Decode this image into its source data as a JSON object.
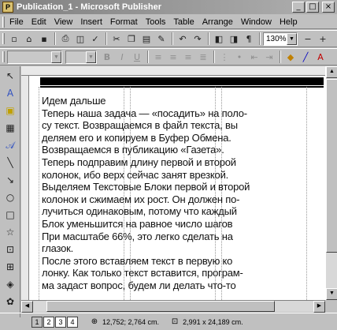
{
  "window": {
    "title": "Publication_1 - Microsoft Publisher",
    "app_icon": "publisher-icon",
    "controls": {
      "minimize": "_",
      "maximize": "□",
      "close": "×"
    }
  },
  "menu": [
    "File",
    "Edit",
    "View",
    "Insert",
    "Format",
    "Tools",
    "Table",
    "Arrange",
    "Window",
    "Help"
  ],
  "toolbar1": {
    "buttons": [
      "new-icon",
      "open-icon",
      "save-icon",
      "print-icon",
      "print-preview-icon",
      "spelling-icon",
      "cut-icon",
      "copy-icon",
      "paste-icon",
      "format-painter-icon",
      "undo-icon",
      "redo-icon",
      "bring-front-icon",
      "send-back-icon",
      "special-chars-icon"
    ],
    "zoom": "130%",
    "zoom_out": "−",
    "zoom_in": "+"
  },
  "toolbar2": {
    "font_name": "",
    "font_size": "",
    "buttons": [
      "bold-icon",
      "italic-icon",
      "underline-icon",
      "align-left-icon",
      "center-icon",
      "align-right-icon",
      "justify-icon",
      "numbering-icon",
      "bullets-icon",
      "decrease-indent-icon",
      "increase-indent-icon",
      "fill-color-icon",
      "line-color-icon",
      "font-color-icon"
    ]
  },
  "left_tools": [
    "pointer-icon",
    "text-box-icon",
    "picture-frame-icon",
    "table-icon",
    "wordart-icon",
    "line-icon",
    "arrow-icon",
    "oval-icon",
    "rectangle-icon",
    "custom-shape-icon",
    "hot-spot-icon",
    "form-control-icon",
    "html-fragment-icon",
    "clip-gallery-icon",
    "design-gallery-icon"
  ],
  "document": {
    "paragraphs": [
      "Идем дальше",
      "Теперь наша задача — «посадить» на поло-",
      "су текст. Возвращаемся в файл текста, вы",
      "деляем его и копируем в Буфер Обмена.",
      "Возвращаемся в публикацию «Газета».",
      "Теперь подправим длину первой и второй",
      "колонок, ибо верх сейчас занят врезкой.",
      "Выделяем Текстовые Блоки первой и второй",
      "колонок и сжимаем их рост. Он должен по-",
      "лучиться одинаковым, потому что каждый",
      "Блок уменьшится на равное число шагов",
      "При масштабе 66%, это легко сделать на",
      "глазок.",
      "После этого вставляем текст в первую ко",
      "лонку. Как только текст вставится, програм-",
      "ма задаст вопрос, будем ли делать что-то"
    ]
  },
  "status": {
    "pages": [
      "1",
      "2",
      "3",
      "4"
    ],
    "active_page": "1",
    "position": "12,752; 2,764 cm.",
    "size": "2,991 x 24,189 cm."
  }
}
